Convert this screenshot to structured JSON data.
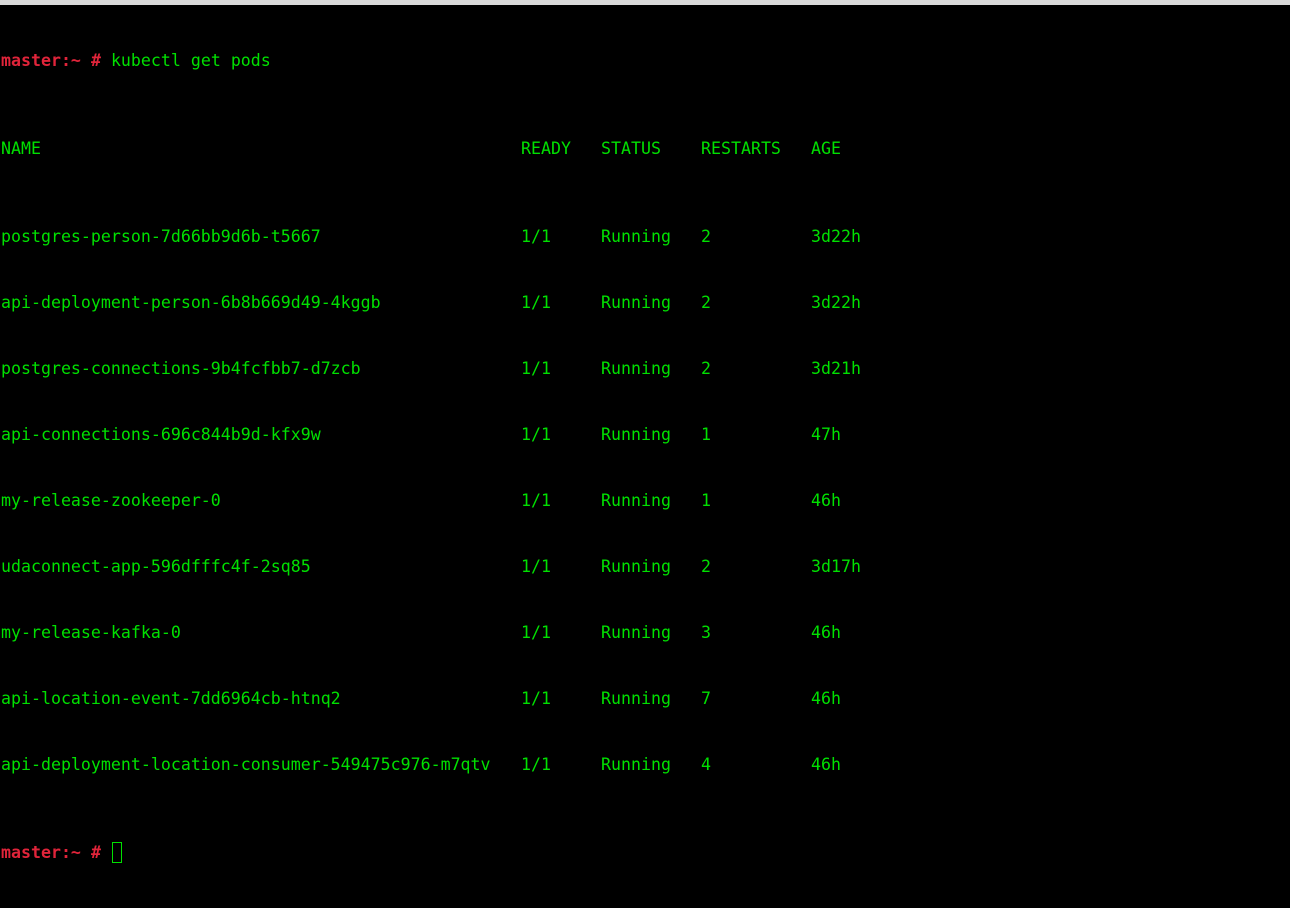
{
  "prompt": {
    "host": "master:~",
    "symbol": "#"
  },
  "command": "kubectl get pods",
  "table": {
    "headers": {
      "name": "NAME",
      "ready": "READY",
      "status": "STATUS",
      "restarts": "RESTARTS",
      "age": "AGE"
    },
    "rows": [
      {
        "name": "postgres-person-7d66bb9d6b-t5667",
        "ready": "1/1",
        "status": "Running",
        "restarts": "2",
        "age": "3d22h"
      },
      {
        "name": "api-deployment-person-6b8b669d49-4kggb",
        "ready": "1/1",
        "status": "Running",
        "restarts": "2",
        "age": "3d22h"
      },
      {
        "name": "postgres-connections-9b4fcfbb7-d7zcb",
        "ready": "1/1",
        "status": "Running",
        "restarts": "2",
        "age": "3d21h"
      },
      {
        "name": "api-connections-696c844b9d-kfx9w",
        "ready": "1/1",
        "status": "Running",
        "restarts": "1",
        "age": "47h"
      },
      {
        "name": "my-release-zookeeper-0",
        "ready": "1/1",
        "status": "Running",
        "restarts": "1",
        "age": "46h"
      },
      {
        "name": "udaconnect-app-596dfffc4f-2sq85",
        "ready": "1/1",
        "status": "Running",
        "restarts": "2",
        "age": "3d17h"
      },
      {
        "name": "my-release-kafka-0",
        "ready": "1/1",
        "status": "Running",
        "restarts": "3",
        "age": "46h"
      },
      {
        "name": "api-location-event-7dd6964cb-htnq2",
        "ready": "1/1",
        "status": "Running",
        "restarts": "7",
        "age": "46h"
      },
      {
        "name": "api-deployment-location-consumer-549475c976-m7qtv",
        "ready": "1/1",
        "status": "Running",
        "restarts": "4",
        "age": "46h"
      }
    ]
  },
  "colors": {
    "background": "#000000",
    "text": "#00e000",
    "prompt": "#e0243a"
  }
}
